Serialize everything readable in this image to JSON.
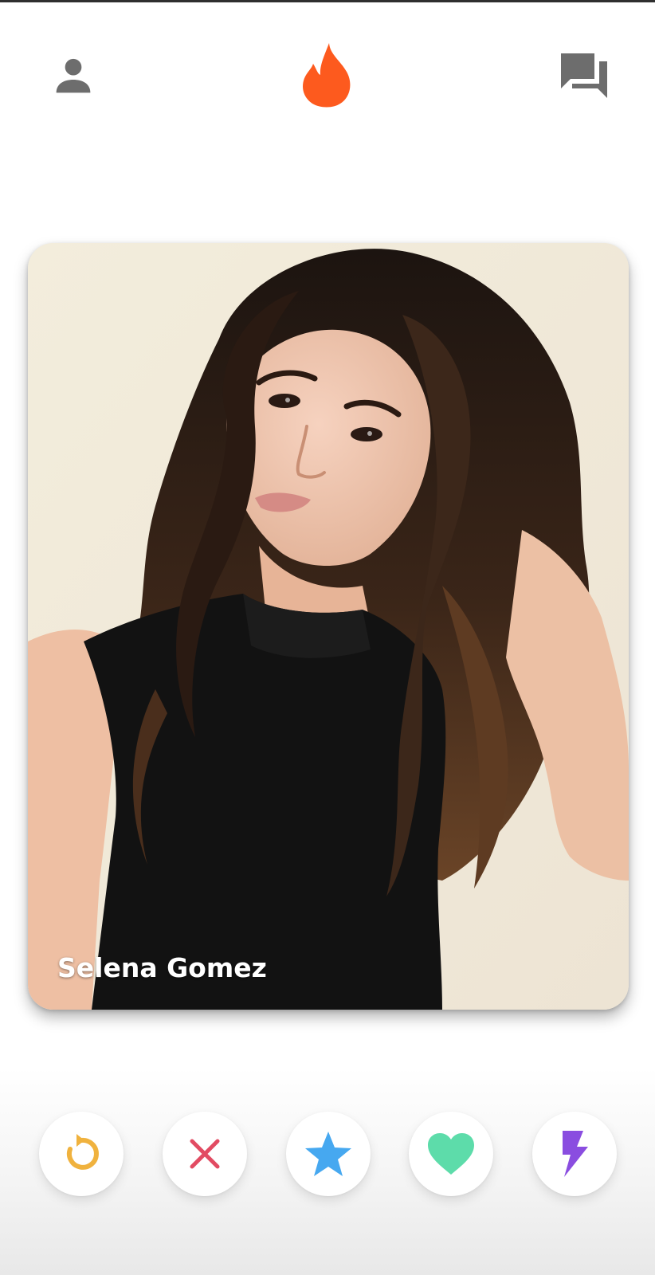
{
  "app": {
    "brand_color": "#fd5a1e"
  },
  "header": {
    "profile_icon": "person-icon",
    "logo_icon": "flame-icon",
    "messages_icon": "chat-bubbles-icon",
    "icon_color": "#6d6d6d"
  },
  "card": {
    "name": "Selena Gomez",
    "photo": "profile-photo"
  },
  "actions": [
    {
      "id": "rewind",
      "icon": "rewind-icon",
      "color": "#f0b23e"
    },
    {
      "id": "nope",
      "icon": "close-x-icon",
      "color": "#e24b62"
    },
    {
      "id": "superlike",
      "icon": "star-icon",
      "color": "#46a8f0"
    },
    {
      "id": "like",
      "icon": "heart-icon",
      "color": "#5ddcaa"
    },
    {
      "id": "boost",
      "icon": "lightning-bolt-icon",
      "color": "#8a4de0"
    }
  ]
}
